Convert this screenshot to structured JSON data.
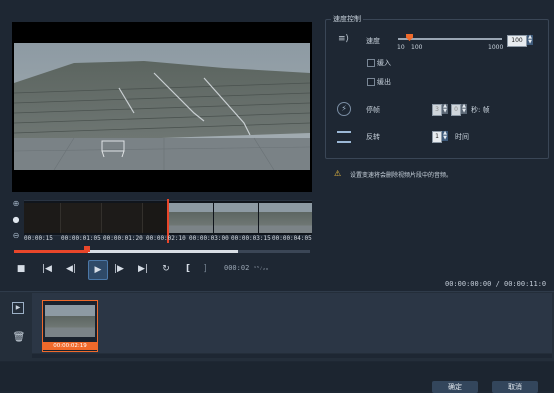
{
  "preview": {
    "timecodes": [
      "00:00:15",
      "00:00:01:05",
      "00:00:01:20",
      "00:00:02:10",
      "00:00:03:00",
      "00:00:03:15",
      "00:00:04:05"
    ],
    "current_time": "000:02 ",
    "current_time_suffix": "¹⁵⁄₂₀",
    "total_time": "00:00:00:00 / 00:00:11:0",
    "scrub_progress": 0.25,
    "controls": {
      "stop": "■",
      "start": "|◀",
      "prev_frame": "◀|",
      "play": "▶",
      "next_frame": "|▶",
      "end": "▶|",
      "repeat": "↻",
      "mark_in": "[",
      "mark_out": "]"
    },
    "zoom_in": "⊕",
    "zoom_knob": "●",
    "zoom_out": "⊖"
  },
  "speed_control": {
    "title": "速度控制",
    "speed_label": "速度",
    "speed_value": "100",
    "slider_min_label": "10",
    "slider_mid_label": "100",
    "slider_max_label": "1000",
    "ease_in_label": "缓入",
    "ease_out_label": "缓出",
    "freeze_label": "停帧",
    "freeze_seconds": "3",
    "freeze_frames": "0",
    "freeze_unit": "秒: 帧",
    "reverse_label": "反转",
    "reverse_count": "1",
    "reverse_unit": "时间"
  },
  "warning": {
    "icon": "warning-icon",
    "text": "设置变速将会删除视频片段中的音频。"
  },
  "timeline": {
    "clip_label": "00:00:02:19"
  },
  "buttons": {
    "ok": "确定",
    "cancel": "取消"
  },
  "colors": {
    "accent": "#f06a2b",
    "playhead": "#e8462a",
    "background": "#1e2733"
  }
}
